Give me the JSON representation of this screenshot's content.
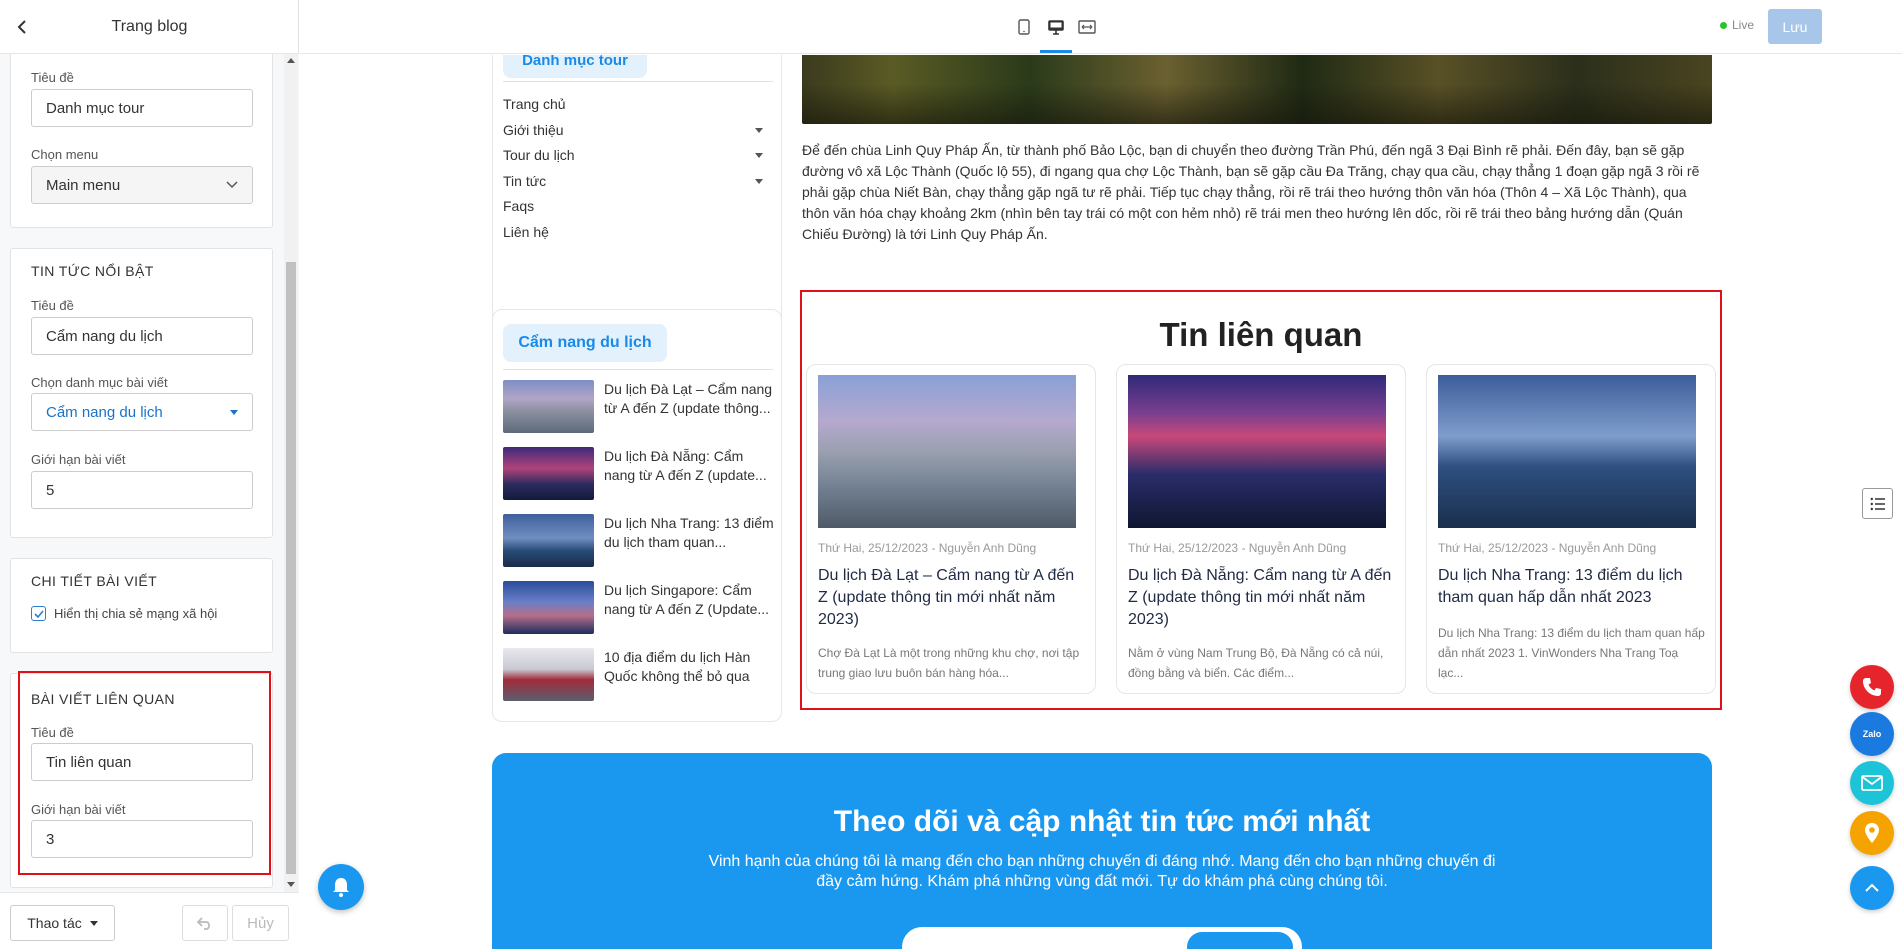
{
  "left_panel": {
    "header_title": "Trang blog",
    "section_menu": {
      "title_label": "Tiêu đề",
      "title_value": "Danh mục tour",
      "menu_label": "Chọn menu",
      "menu_value": "Main menu"
    },
    "section_featured": {
      "heading": "TIN TỨC NỔI BẬT",
      "title_label": "Tiêu đề",
      "title_value": "Cẩm nang du lịch",
      "category_label": "Chọn danh mục bài viết",
      "category_value": "Cẩm nang du lịch",
      "limit_label": "Giới hạn bài viết",
      "limit_value": "5"
    },
    "section_detail": {
      "heading": "CHI TIẾT BÀI VIẾT",
      "share_label": "Hiển thị chia sẻ mạng xã hội",
      "share_checked": true
    },
    "section_related": {
      "heading": "BÀI VIẾT LIÊN QUAN",
      "title_label": "Tiêu đề",
      "title_value": "Tin liên quan",
      "limit_label": "Giới hạn bài viết",
      "limit_value": "3"
    },
    "footer": {
      "action_label": "Thao tác",
      "cancel_label": "Hủy"
    }
  },
  "topbar": {
    "live_label": "Live",
    "save_label": "Lưu",
    "devices": [
      "mobile-icon",
      "desktop-icon",
      "fullwidth-icon"
    ],
    "active_device": "desktop-icon",
    "colors": {
      "live_dot": "#2bc32b",
      "save_bg": "#a7c6ea"
    }
  },
  "preview": {
    "menu_box": {
      "tag": "Danh mục tour",
      "items": [
        {
          "label": "Trang chủ",
          "has_caret": false
        },
        {
          "label": "Giới thiệu",
          "has_caret": true
        },
        {
          "label": "Tour du lịch",
          "has_caret": true
        },
        {
          "label": "Tin tức",
          "has_caret": true
        },
        {
          "label": "Faqs",
          "has_caret": false
        },
        {
          "label": "Liên hệ",
          "has_caret": false
        }
      ]
    },
    "news_box": {
      "tag": "Cẩm nang du lịch",
      "items": [
        {
          "title": "Du lịch Đà Lạt – Cẩm nang từ A đến Z (update thông..."
        },
        {
          "title": "Du lịch Đà Nẵng: Cẩm nang từ A đến Z (update..."
        },
        {
          "title": "Du lịch Nha Trang: 13 điểm du lịch tham quan..."
        },
        {
          "title": "Du lịch Singapore: Cẩm nang từ A đến Z (Update..."
        },
        {
          "title": "10 địa điểm du lịch Hàn Quốc không thể bỏ qua"
        }
      ]
    },
    "article_text": "Để đến chùa Linh Quy Pháp Ấn, từ thành phố Bảo Lộc, bạn di chuyển theo đường Trần Phú, đến ngã 3 Đại Bình rẽ phải. Đến đây, bạn sẽ gặp đường vô xã Lộc Thành (Quốc lộ 55), đi ngang qua chợ Lộc Thành, bạn sẽ gặp cầu Đa Trăng, chạy qua cầu, chạy thẳng 1 đoạn gặp ngã 3 rồi rẽ phải gặp chùa Niết Bàn, chạy thẳng gặp ngã tư rẽ phải. Tiếp tục chạy thẳng, rồi rẽ trái theo hướng thôn văn hóa (Thôn 4 – Xã Lộc Thành), qua thôn văn hóa chạy khoảng 2km (nhìn bên tay trái có một con hẻm nhỏ) rẽ trái men theo hướng lên dốc, rồi rẽ trái theo bảng hướng dẫn (Quán Chiếu Đường) là tới Linh Quy Pháp Ấn.",
    "related": {
      "title": "Tin liên quan",
      "cards": [
        {
          "meta": "Thứ Hai, 25/12/2023 - Nguyễn Anh Dũng",
          "title": "Du lịch Đà Lạt – Cẩm nang từ A đến Z (update thông tin mới nhất năm 2023)",
          "desc": "Chợ Đà Lạt Là một trong những khu chợ, nơi tập trung giao lưu buôn bán hàng hóa..."
        },
        {
          "meta": "Thứ Hai, 25/12/2023 - Nguyễn Anh Dũng",
          "title": "Du lịch Đà Nẵng: Cẩm nang từ A đến Z (update thông tin mới nhất năm 2023)",
          "desc": "Nằm ở vùng Nam Trung Bộ, Đà Nẵng có cả núi, đồng bằng và biển. Các điểm..."
        },
        {
          "meta": "Thứ Hai, 25/12/2023 - Nguyễn Anh Dũng",
          "title": "Du lịch Nha Trang: 13 điểm du lịch tham quan hấp dẫn nhất 2023",
          "desc": "Du lịch Nha Trang: 13 điểm du lịch tham quan hấp dẫn nhất 2023 1. VinWonders Nha Trang Toạ lạc..."
        }
      ]
    },
    "subscribe": {
      "title": "Theo dõi và cập nhật tin tức mới nhất",
      "text": "Vinh hạnh của chúng tôi là mang đến cho bạn những chuyến đi đáng nhớ. Mang đến cho bạn những chuyến đi đầy cảm hứng. Khám phá những vùng đất mới. Tự do khám phá cùng chúng tôi."
    }
  },
  "floating": {
    "buttons": [
      {
        "icon": "phone-icon",
        "color": "#e5242b"
      },
      {
        "icon": "zalo-icon",
        "color": "#1a7ae0",
        "text": "Zalo"
      },
      {
        "icon": "mail-icon",
        "color": "#1dc4d8"
      },
      {
        "icon": "location-icon",
        "color": "#f5a300"
      },
      {
        "icon": "scroll-top-icon",
        "color": "#1a98f0"
      }
    ]
  }
}
